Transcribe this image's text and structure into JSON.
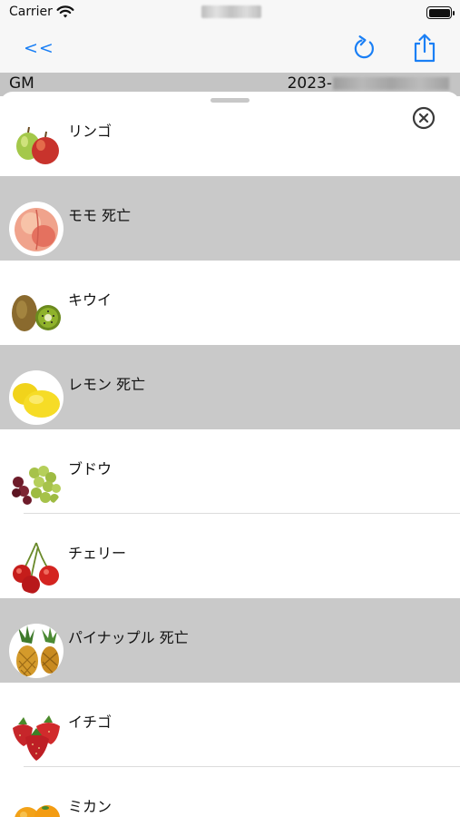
{
  "status_bar": {
    "carrier": "Carrier"
  },
  "nav": {
    "back_label": "<<"
  },
  "info_bar": {
    "left_label": "GM",
    "date_prefix": "2023-"
  },
  "fruits": [
    {
      "label": "リンゴ",
      "icon": "apple-icon",
      "dead": false
    },
    {
      "label": "モモ 死亡",
      "icon": "peach-icon",
      "dead": true
    },
    {
      "label": "キウイ",
      "icon": "kiwi-icon",
      "dead": false
    },
    {
      "label": "レモン 死亡",
      "icon": "lemon-icon",
      "dead": true
    },
    {
      "label": "ブドウ",
      "icon": "grape-icon",
      "dead": false
    },
    {
      "label": "チェリー",
      "icon": "cherry-icon",
      "dead": false
    },
    {
      "label": "パイナップル 死亡",
      "icon": "pineapple-icon",
      "dead": true
    },
    {
      "label": "イチゴ",
      "icon": "strawberry-icon",
      "dead": false
    },
    {
      "label": "ミカン",
      "icon": "orange-icon",
      "dead": false
    }
  ],
  "colors": {
    "accent": "#1a7ff5",
    "dead_row": "#c9c9c9",
    "info_bar": "#c4c4c4",
    "nav_background": "#f7f7f7"
  }
}
